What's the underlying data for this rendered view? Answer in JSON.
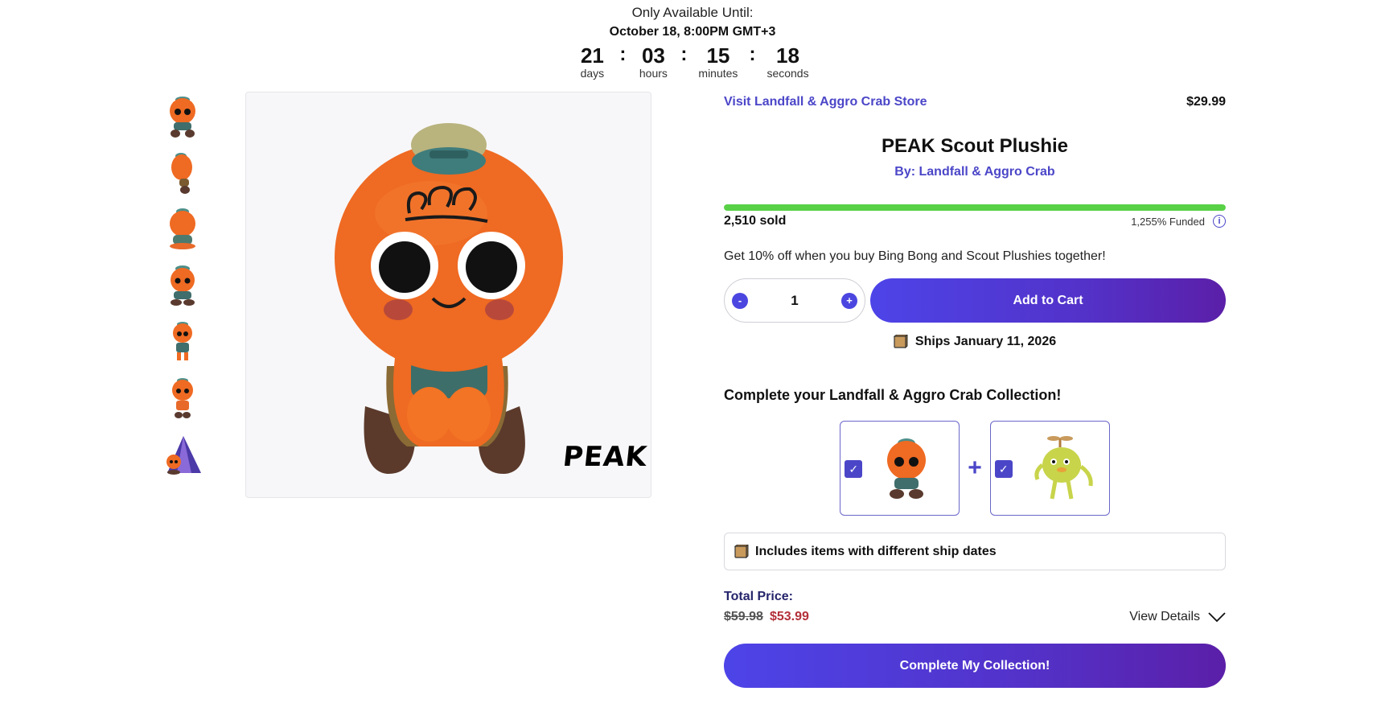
{
  "countdown": {
    "label": "Only Available Until:",
    "date": "October 18, 8:00PM GMT+3",
    "units": [
      {
        "value": "21",
        "label": "days"
      },
      {
        "value": "03",
        "label": "hours"
      },
      {
        "value": "15",
        "label": "minutes"
      },
      {
        "value": "18",
        "label": "seconds"
      }
    ],
    "separator": ":"
  },
  "gallery": {
    "thumbnails": [
      "scout-front",
      "scout-side",
      "scout-back",
      "scout-seated",
      "scout-standing",
      "scout-front-2",
      "scout-with-tent"
    ],
    "logo_text": "PEAK"
  },
  "product": {
    "store_link": "Visit Landfall & Aggro Crab Store",
    "price": "$29.99",
    "title": "PEAK Scout Plushie",
    "byline": "By: Landfall & Aggro Crab",
    "funding_progress": 1.0,
    "sold": "2,510 sold",
    "funded": "1,255% Funded",
    "info_icon": "i",
    "promo": "Get 10% off when you buy Bing Bong and Scout Plushies together!"
  },
  "cart": {
    "minus": "-",
    "quantity": "1",
    "plus": "+",
    "add_label": "Add to Cart",
    "ships": "Ships January 11, 2026"
  },
  "collection": {
    "title": "Complete your Landfall & Aggro Crab Collection!",
    "check": "✓",
    "plus": "+",
    "notice": "Includes items with different ship dates",
    "total_label": "Total Price:",
    "old_price": "$59.98",
    "new_price": "$53.99",
    "view_details": "View Details",
    "button": "Complete My Collection!"
  },
  "colors": {
    "accent": "#4b46c8",
    "progress": "#58d146",
    "sale": "#b3303a",
    "plush_orange": "#ef6a22"
  }
}
